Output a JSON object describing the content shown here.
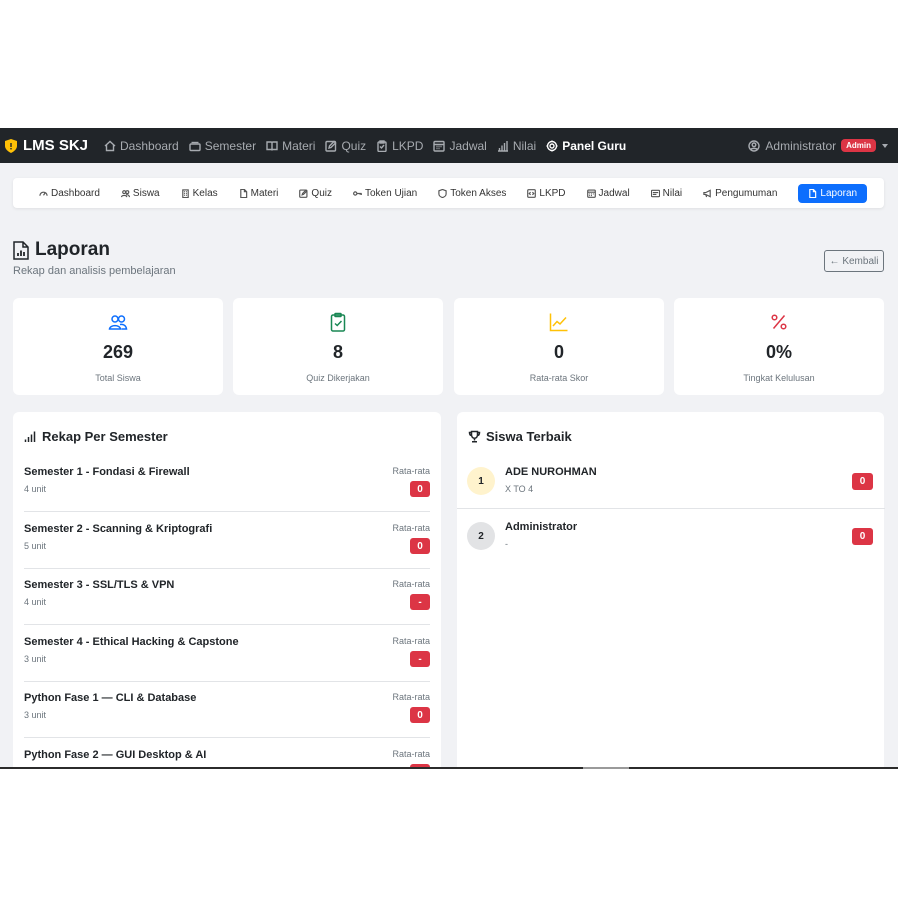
{
  "navbar": {
    "brand": "LMS SKJ",
    "links": [
      {
        "label": "Dashboard",
        "icon": "home-icon"
      },
      {
        "label": "Semester",
        "icon": "layers-icon"
      },
      {
        "label": "Materi",
        "icon": "book-icon"
      },
      {
        "label": "Quiz",
        "icon": "edit-icon"
      },
      {
        "label": "LKPD",
        "icon": "clipboard-icon"
      },
      {
        "label": "Jadwal",
        "icon": "calendar-icon"
      },
      {
        "label": "Nilai",
        "icon": "bar-chart-icon"
      },
      {
        "label": "Panel Guru",
        "icon": "gear-icon"
      }
    ],
    "user": "Administrator",
    "role_badge": "Admin"
  },
  "subnav": {
    "items": [
      {
        "label": "Dashboard",
        "icon": "speedometer-icon"
      },
      {
        "label": "Siswa",
        "icon": "people-icon"
      },
      {
        "label": "Kelas",
        "icon": "building-icon"
      },
      {
        "label": "Materi",
        "icon": "file-icon"
      },
      {
        "label": "Quiz",
        "icon": "edit-icon"
      },
      {
        "label": "Token Ujian",
        "icon": "key-icon"
      },
      {
        "label": "Token Akses",
        "icon": "shield-icon"
      },
      {
        "label": "LKPD",
        "icon": "code-icon"
      },
      {
        "label": "Jadwal",
        "icon": "calendar-icon"
      },
      {
        "label": "Nilai",
        "icon": "card-icon"
      },
      {
        "label": "Pengumuman",
        "icon": "megaphone-icon"
      },
      {
        "label": "Laporan",
        "icon": "report-icon"
      }
    ],
    "active": "Laporan"
  },
  "header": {
    "title": "Laporan",
    "subtitle": "Rekap dan analisis pembelajaran",
    "back_label": "← Kembali"
  },
  "stats": [
    {
      "value": "269",
      "label": "Total Siswa",
      "color": "#0d6efd",
      "icon": "people-icon"
    },
    {
      "value": "8",
      "label": "Quiz Dikerjakan",
      "color": "#198754",
      "icon": "clipboard-check-icon"
    },
    {
      "value": "0",
      "label": "Rata-rata Skor",
      "color": "#ffc107",
      "icon": "graph-up-icon"
    },
    {
      "value": "0%",
      "label": "Tingkat Kelulusan",
      "color": "#dc3545",
      "icon": "percent-icon"
    }
  ],
  "semester_panel": {
    "title": "Rekap Per Semester",
    "rows": [
      {
        "name": "Semester 1 - Fondasi & Firewall",
        "units": "4 unit",
        "avg_label": "Rata-rata",
        "avg": "0"
      },
      {
        "name": "Semester 2 - Scanning & Kriptografi",
        "units": "5 unit",
        "avg_label": "Rata-rata",
        "avg": "0"
      },
      {
        "name": "Semester 3 - SSL/TLS & VPN",
        "units": "4 unit",
        "avg_label": "Rata-rata",
        "avg": "-"
      },
      {
        "name": "Semester 4 - Ethical Hacking & Capstone",
        "units": "3 unit",
        "avg_label": "Rata-rata",
        "avg": "-"
      },
      {
        "name": "Python Fase 1 — CLI & Database",
        "units": "3 unit",
        "avg_label": "Rata-rata",
        "avg": "0"
      },
      {
        "name": "Python Fase 2 — GUI Desktop & AI",
        "units": "",
        "avg_label": "Rata-rata",
        "avg": ""
      }
    ]
  },
  "students_panel": {
    "title": "Siswa Terbaik",
    "rows": [
      {
        "rank": "1",
        "name": "ADE NUROHMAN",
        "class": "X TO 4",
        "score": "0"
      },
      {
        "rank": "2",
        "name": "Administrator",
        "class": "-",
        "score": "0"
      }
    ]
  }
}
